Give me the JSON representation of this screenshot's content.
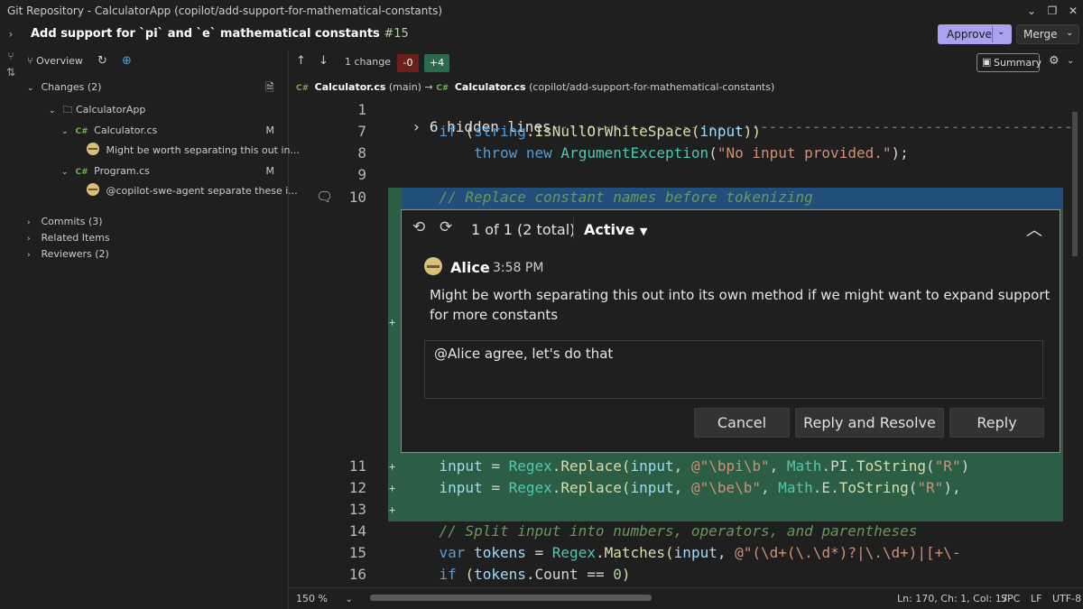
{
  "window": {
    "title": "Git Repository - CalculatorApp (copilot/add-support-for-mathematical-constants)"
  },
  "pr": {
    "title": "Add support for `pi` and `e` mathematical constants",
    "number": "#15",
    "approve_label": "Approve",
    "merge_label": "Merge"
  },
  "sidebar": {
    "overview_label": "Overview",
    "changes_label": "Changes (2)",
    "folder": "CalculatorApp",
    "files": [
      {
        "lang": "C#",
        "name": "Calculator.cs",
        "status": "M",
        "comment": "Might be worth separating this out in..."
      },
      {
        "lang": "C#",
        "name": "Program.cs",
        "status": "M",
        "comment": "@copilot-swe-agent separate these i..."
      }
    ],
    "sections": [
      "Commits (3)",
      "Related Items",
      "Reviewers (2)"
    ]
  },
  "toolbar": {
    "change_count": "1 change",
    "removed": "-0",
    "added": "+4",
    "summary_label": "Summary"
  },
  "path": {
    "left_lang": "C#",
    "left_file": "Calculator.cs",
    "left_branch": "(main)",
    "arrow": "→",
    "right_lang": "C#",
    "right_file": "Calculator.cs",
    "right_branch": "(copilot/add-support-for-mathematical-constants)"
  },
  "editor": {
    "hidden_lines_label": "6 hidden lines",
    "line_numbers": [
      "1",
      "7",
      "8",
      "9",
      "10",
      "11",
      "12",
      "13",
      "14",
      "15",
      "16"
    ]
  },
  "comment": {
    "counter": "1 of 1 (2 total)",
    "status": "Active",
    "author": "Alice",
    "time": "3:58 PM",
    "body": "Might be worth separating this out into its own method if we might want to expand support for more constants",
    "reply_text": "@Alice agree, let's do that",
    "cancel_label": "Cancel",
    "reply_resolve_label": "Reply and Resolve",
    "reply_label": "Reply"
  },
  "status": {
    "zoom": "150 %",
    "position": "Ln: 170, Ch: 1, Col: 17",
    "indent": "SPC",
    "eol": "LF",
    "encoding": "UTF-8"
  }
}
